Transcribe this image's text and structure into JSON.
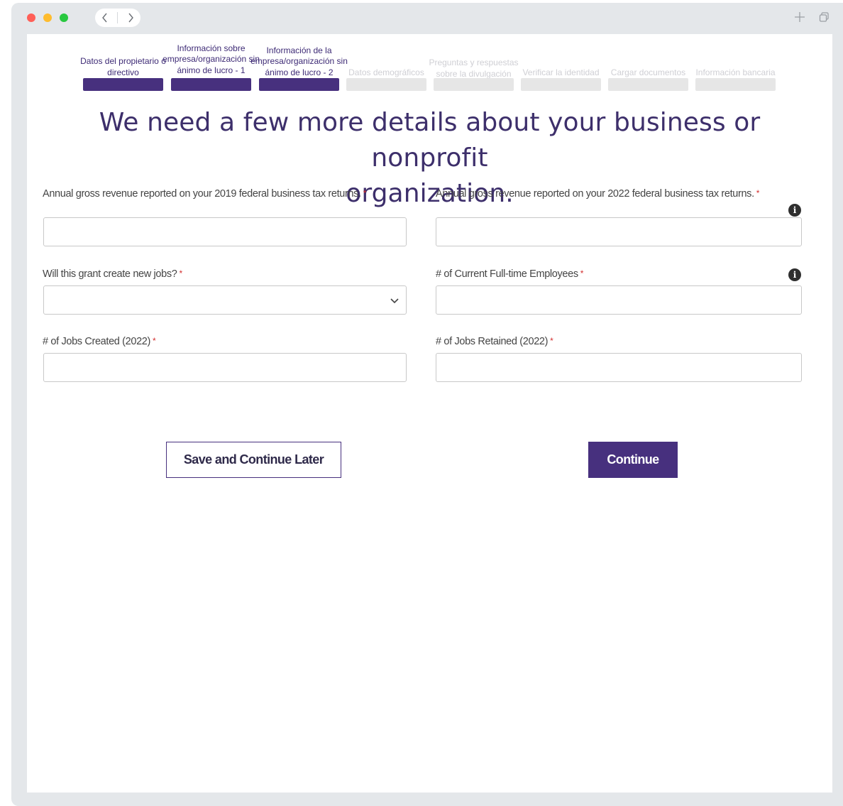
{
  "window": {
    "controls": [
      "close-dot",
      "minimize-dot",
      "maximize-dot"
    ],
    "nav_icons": [
      "chevron-left-icon",
      "chevron-right-icon"
    ],
    "right_icons": [
      "plus-icon",
      "restore-window-icon"
    ]
  },
  "stepper": {
    "steps": [
      {
        "label": "Datos del propietario o directivo",
        "state": "complete"
      },
      {
        "label": "Información sobre empresa/organización sin ánimo de lucro - 1",
        "state": "complete"
      },
      {
        "label": "Información de la empresa/organización sin ánimo de lucro - 2",
        "state": "complete"
      },
      {
        "label": "Datos demográficos",
        "state": "inactive"
      },
      {
        "label": "Preguntas y respuestas sobre la divulgación",
        "state": "inactive"
      },
      {
        "label": "Verificar la identidad",
        "state": "inactive"
      },
      {
        "label": "Cargar documentos",
        "state": "inactive"
      },
      {
        "label": "Información bancaria",
        "state": "inactive"
      }
    ],
    "active_color": "#47307e",
    "inactive_color": "#e6e6e6"
  },
  "heading": {
    "line1": "We need a few more details about your business or nonprofit",
    "line2": "organization."
  },
  "form": {
    "revenue_2019": {
      "label": "Annual gross revenue reported on your 2019 federal business tax returns.",
      "value": "",
      "required": "*"
    },
    "revenue_2022": {
      "label": "Annual gross revenue reported on your 2022 federal business tax returns.",
      "value": "",
      "required": "*"
    },
    "new_jobs": {
      "label": "Will this grant create new jobs?",
      "selected": "",
      "required": "*"
    },
    "fulltime_employees": {
      "label": "# of Current Full-time Employees",
      "value": "",
      "required": "*"
    },
    "jobs_created": {
      "label": "# of Jobs Created (2022)",
      "value": "",
      "required": "*"
    },
    "jobs_retained": {
      "label": "# of Jobs Retained (2022)",
      "value": "",
      "required": "*"
    }
  },
  "buttons": {
    "save_later": "Save and Continue Later",
    "continue": "Continue"
  },
  "colors": {
    "brand": "#47307e",
    "required": "#d32f2f",
    "heading": "#3d2f6b"
  }
}
